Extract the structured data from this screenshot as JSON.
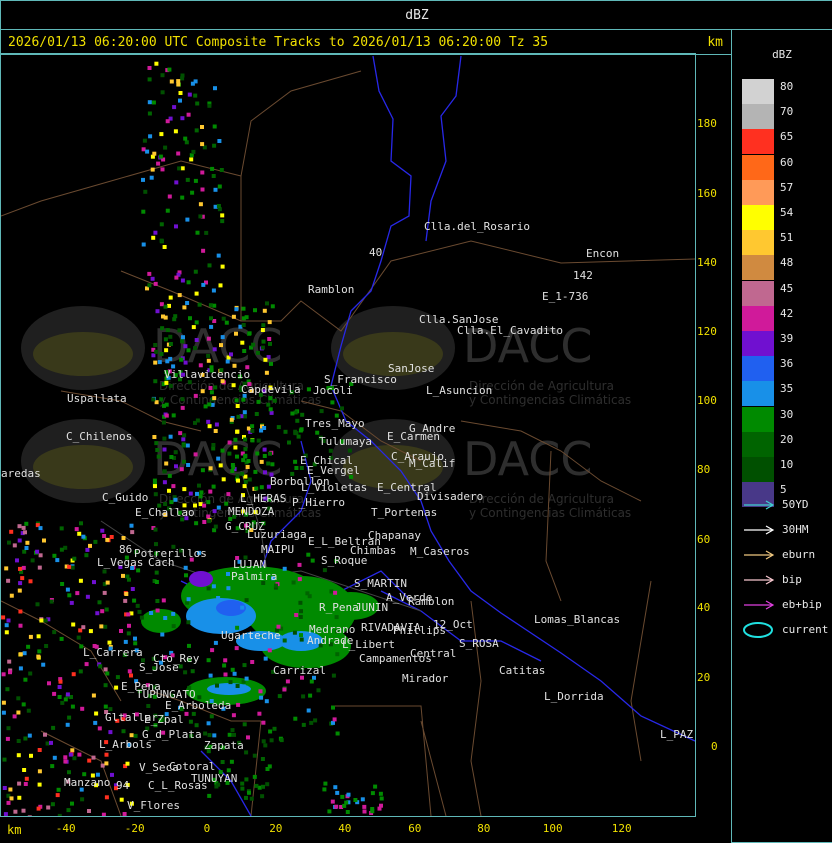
{
  "window_title": "dBZ",
  "header": {
    "text": "2026/01/13 06:20:00 UTC Composite Tracks to 2026/01/13 06:20:00 Tz 35",
    "km": "km"
  },
  "x_axis": {
    "unit": "km",
    "ticks": [
      "-40",
      "-20",
      "0",
      "20",
      "40",
      "60",
      "80",
      "100",
      "120"
    ]
  },
  "y_axis": {
    "unit": "km",
    "ticks": [
      "180",
      "160",
      "140",
      "120",
      "100",
      "80",
      "60",
      "40",
      "20",
      "0"
    ]
  },
  "legend": {
    "unit": "dBZ",
    "levels": [
      {
        "label": "80",
        "color": "#d2d2d2"
      },
      {
        "label": "70",
        "color": "#b4b4b4"
      },
      {
        "label": "65",
        "color": "#ff3020"
      },
      {
        "label": "60",
        "color": "#ff6818"
      },
      {
        "label": "57",
        "color": "#ff9a58"
      },
      {
        "label": "54",
        "color": "#ffff00"
      },
      {
        "label": "51",
        "color": "#ffc830"
      },
      {
        "label": "48",
        "color": "#d08a40"
      },
      {
        "label": "45",
        "color": "#c06890"
      },
      {
        "label": "42",
        "color": "#d01a9a"
      },
      {
        "label": "39",
        "color": "#7010d0"
      },
      {
        "label": "36",
        "color": "#2060f0"
      },
      {
        "label": "35",
        "color": "#1890e8"
      },
      {
        "label": "30",
        "color": "#008a00"
      },
      {
        "label": "20",
        "color": "#006400"
      },
      {
        "label": "10",
        "color": "#005000"
      },
      {
        "label": "5",
        "color": "#483888"
      }
    ],
    "tracks": [
      {
        "label": "50YD",
        "color": "#40d0d0"
      },
      {
        "label": "30HM",
        "color": "#ffffff"
      },
      {
        "label": "eburn",
        "color": "#f0c880"
      },
      {
        "label": "bip",
        "color": "#f8c8d0"
      },
      {
        "label": "eb+bip",
        "color": "#e040e0"
      },
      {
        "label": "current",
        "color": "#20e0e0"
      }
    ]
  },
  "watermark": {
    "brand": "DACC",
    "line1": "Dirección de Agricultura",
    "line2": "y Contingencias Climáticas"
  },
  "places": [
    {
      "name": "Clla.del_Rosario"
    },
    {
      "name": "Encon"
    },
    {
      "name": "142"
    },
    {
      "name": "E_1-736"
    },
    {
      "name": "Ramblon"
    },
    {
      "name": "Clla.SanJose"
    },
    {
      "name": "Clla.El_Cavadito"
    },
    {
      "name": "Villavicencio"
    },
    {
      "name": "S_Francisco"
    },
    {
      "name": "SanJose"
    },
    {
      "name": "Capdevila"
    },
    {
      "name": "Jocoli"
    },
    {
      "name": "L_Asuncion"
    },
    {
      "name": "Uspallata"
    },
    {
      "name": "Tres_Mayo"
    },
    {
      "name": "G_Andre"
    },
    {
      "name": "E_Carmen"
    },
    {
      "name": "C_Chilenos"
    },
    {
      "name": "Tulumaya"
    },
    {
      "name": "C_Araujo"
    },
    {
      "name": "E_Chical"
    },
    {
      "name": "M_Calif"
    },
    {
      "name": "E_Vergel"
    },
    {
      "name": "aredas"
    },
    {
      "name": "Borbollon"
    },
    {
      "name": "E_Central"
    },
    {
      "name": "L_Violetas"
    },
    {
      "name": "Divisadero"
    },
    {
      "name": "C_Guido"
    },
    {
      "name": "L_HERAS"
    },
    {
      "name": "P_Hierro"
    },
    {
      "name": "E_Challao"
    },
    {
      "name": "MENDOZA"
    },
    {
      "name": "T_Portenas"
    },
    {
      "name": "G_CRUZ"
    },
    {
      "name": "Chapanay"
    },
    {
      "name": "Luzuriaga"
    },
    {
      "name": "E_L_Beltran"
    },
    {
      "name": "MAIPU"
    },
    {
      "name": "Chimbas"
    },
    {
      "name": "M_Caseros"
    },
    {
      "name": "Potrerillos"
    },
    {
      "name": "L_Vegas"
    },
    {
      "name": "Cach"
    },
    {
      "name": "LUJAN"
    },
    {
      "name": "S_Roque"
    },
    {
      "name": "S_MARTIN"
    },
    {
      "name": "Palmira"
    },
    {
      "name": "A_Verde"
    },
    {
      "name": "Ramblon"
    },
    {
      "name": "R_Pena"
    },
    {
      "name": "JUNIN"
    },
    {
      "name": "Lomas_Blancas"
    },
    {
      "name": "Ugarteche"
    },
    {
      "name": "Medrano"
    },
    {
      "name": "RIVADAVIA"
    },
    {
      "name": "Phillips"
    },
    {
      "name": "12_Oct"
    },
    {
      "name": "Andrade"
    },
    {
      "name": "L_Libert"
    },
    {
      "name": "S_ROSA"
    },
    {
      "name": "L_Carrera"
    },
    {
      "name": "Cto_Rey"
    },
    {
      "name": "Campamentos"
    },
    {
      "name": "Central"
    },
    {
      "name": "S_Jose"
    },
    {
      "name": "Carrizal"
    },
    {
      "name": "Catitas"
    },
    {
      "name": "E_Pena"
    },
    {
      "name": "TUPUNGATO"
    },
    {
      "name": "Mirador"
    },
    {
      "name": "L_Dorrida"
    },
    {
      "name": "E_Arboleda"
    },
    {
      "name": "Gltallar"
    },
    {
      "name": "E_Zpal"
    },
    {
      "name": "G_d_Plata"
    },
    {
      "name": "L_Arbols"
    },
    {
      "name": "Zapata"
    },
    {
      "name": "L_PAZ"
    },
    {
      "name": "V_Seca"
    },
    {
      "name": "Cotoral"
    },
    {
      "name": "TUNUYAN"
    },
    {
      "name": "Manzano"
    },
    {
      "name": "C_L_Rosas"
    },
    {
      "name": "V_Flores"
    },
    {
      "name": "40"
    },
    {
      "name": "94"
    },
    {
      "name": "86"
    }
  ]
}
